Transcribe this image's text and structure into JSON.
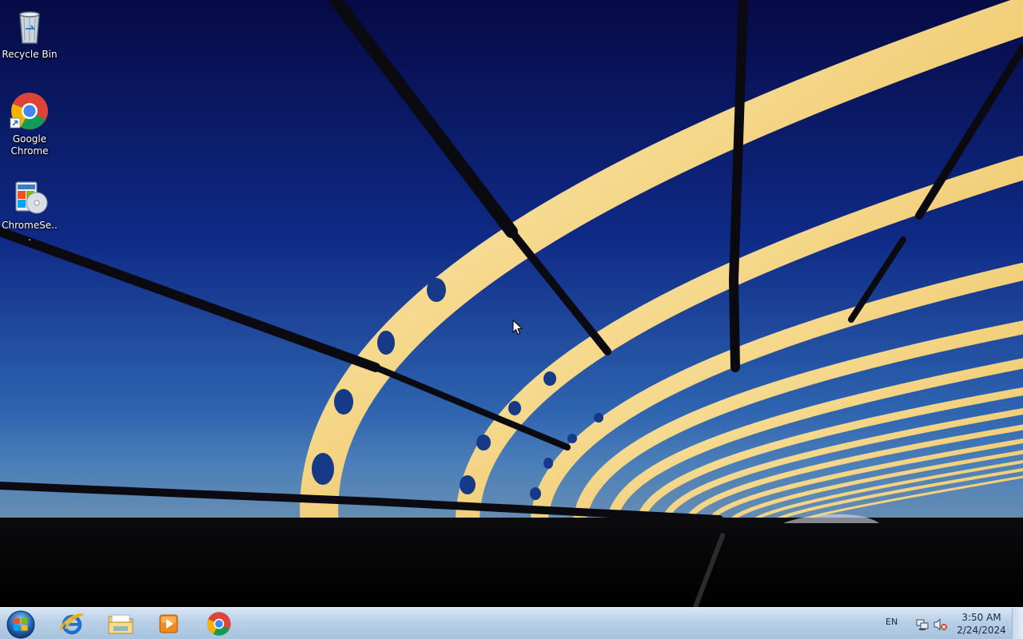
{
  "desktop": {
    "icons": [
      {
        "label": "Recycle Bin",
        "icon": "recycle-bin-icon"
      },
      {
        "label": "Google Chrome",
        "icon": "chrome-icon"
      },
      {
        "label": "ChromeSe...",
        "icon": "installer-icon"
      }
    ]
  },
  "taskbar": {
    "start": {
      "icon": "windows-start-icon"
    },
    "pinned": [
      {
        "name": "Internet Explorer",
        "icon": "internet-explorer-icon"
      },
      {
        "name": "Windows Explorer",
        "icon": "file-explorer-icon"
      },
      {
        "name": "Windows Media Player",
        "icon": "media-player-icon"
      },
      {
        "name": "Google Chrome",
        "icon": "chrome-icon"
      }
    ],
    "tray": {
      "language": "EN",
      "time": "3:50 AM",
      "date": "2/24/2024"
    }
  },
  "colors": {
    "sky_top": "#070c4a",
    "sky_bottom": "#3a72b8",
    "arch_gold": "#f3d98a",
    "taskbar": "#b8cfe6"
  }
}
